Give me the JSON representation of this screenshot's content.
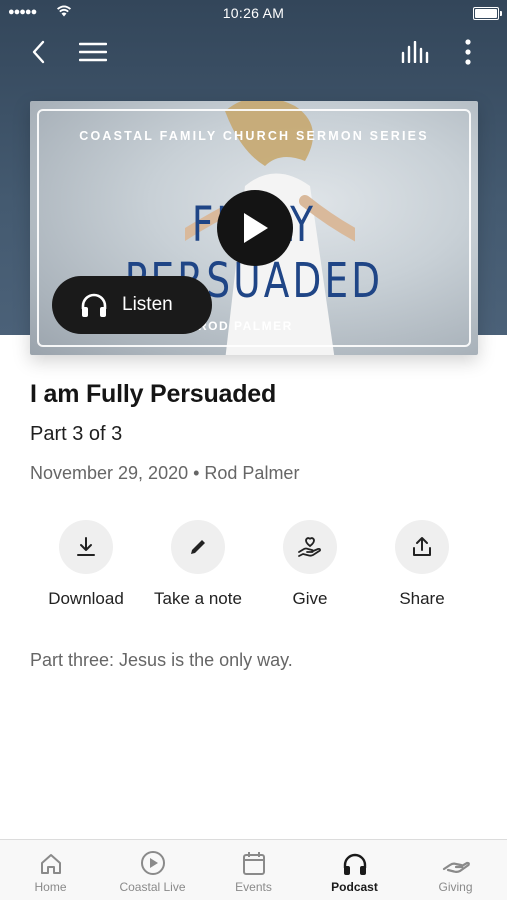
{
  "status_bar": {
    "time": "10:26 AM"
  },
  "artwork": {
    "series": "COASTAL FAMILY CHURCH SERMON SERIES",
    "title": "FULLY PERSUADED",
    "speaker": "ROD PALMER"
  },
  "player": {
    "listen_label": "Listen"
  },
  "sermon": {
    "title": "I am Fully Persuaded",
    "part": "Part 3 of 3",
    "meta": "November 29, 2020 • Rod Palmer",
    "description": "Part three: Jesus is the only way."
  },
  "actions": [
    {
      "label": "Download",
      "icon": "download-icon"
    },
    {
      "label": "Take a note",
      "icon": "pencil-icon"
    },
    {
      "label": "Give",
      "icon": "give-hand-heart-icon"
    },
    {
      "label": "Share",
      "icon": "share-icon"
    }
  ],
  "tabs": [
    {
      "label": "Home",
      "icon": "home-icon",
      "active": false
    },
    {
      "label": "Coastal Live",
      "icon": "play-circle-icon",
      "active": false
    },
    {
      "label": "Events",
      "icon": "calendar-icon",
      "active": false
    },
    {
      "label": "Podcast",
      "icon": "headphones-icon",
      "active": true
    },
    {
      "label": "Giving",
      "icon": "giving-hand-icon",
      "active": false
    }
  ],
  "colors": {
    "hero_bg": "#3f5368",
    "title_blue": "#1f4586",
    "button_dark": "#1a1a1a"
  }
}
